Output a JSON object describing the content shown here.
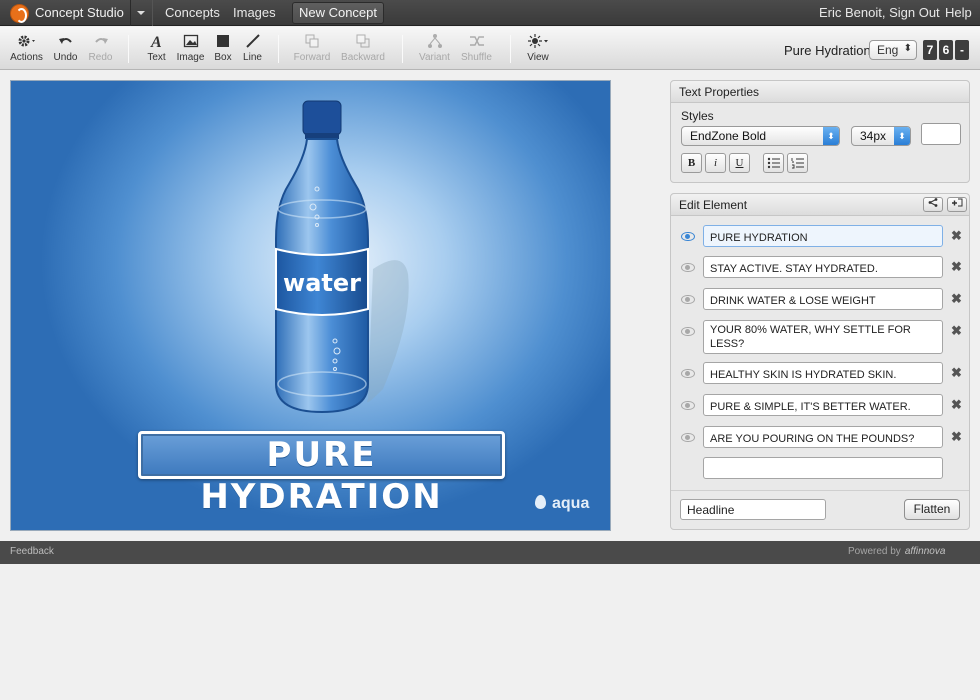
{
  "topnav": {
    "app_title": "Concept Studio",
    "concepts": "Concepts",
    "images": "Images",
    "new_concept": "New Concept",
    "user": "Eric Benoit, Sign Out",
    "help": "Help"
  },
  "toolbar": {
    "actions": "Actions",
    "undo": "Undo",
    "redo": "Redo",
    "text": "Text",
    "image": "Image",
    "box": "Box",
    "line": "Line",
    "forward": "Forward",
    "backward": "Backward",
    "variant": "Variant",
    "shuffle": "Shuffle",
    "view": "View",
    "concept_name": "Pure Hydration",
    "language": "Eng",
    "counter": [
      "7",
      "6",
      "-"
    ]
  },
  "canvas": {
    "bottle_label": "water",
    "headline": "PURE HYDRATION",
    "brand": "aqua"
  },
  "text_properties": {
    "title": "Text Properties",
    "styles_label": "Styles",
    "font": "EndZone Bold",
    "size": "34px",
    "bold": "B",
    "italic": "i",
    "underline": "U"
  },
  "edit_element": {
    "title": "Edit Element",
    "items": [
      {
        "text": "PURE HYDRATION"
      },
      {
        "text": "STAY ACTIVE. STAY HYDRATED."
      },
      {
        "text": "DRINK WATER & LOSE WEIGHT"
      },
      {
        "text": "YOUR 80% WATER, WHY SETTLE FOR LESS?"
      },
      {
        "text": "HEALTHY SKIN IS HYDRATED SKIN."
      },
      {
        "text": "PURE & SIMPLE, IT'S BETTER WATER."
      },
      {
        "text": "ARE YOU POURING ON THE POUNDS?"
      }
    ],
    "empty_value": "",
    "element_type": "Headline",
    "flatten": "Flatten"
  },
  "footer": {
    "feedback": "Feedback",
    "powered_by": "Powered by",
    "company": "affinnova"
  }
}
